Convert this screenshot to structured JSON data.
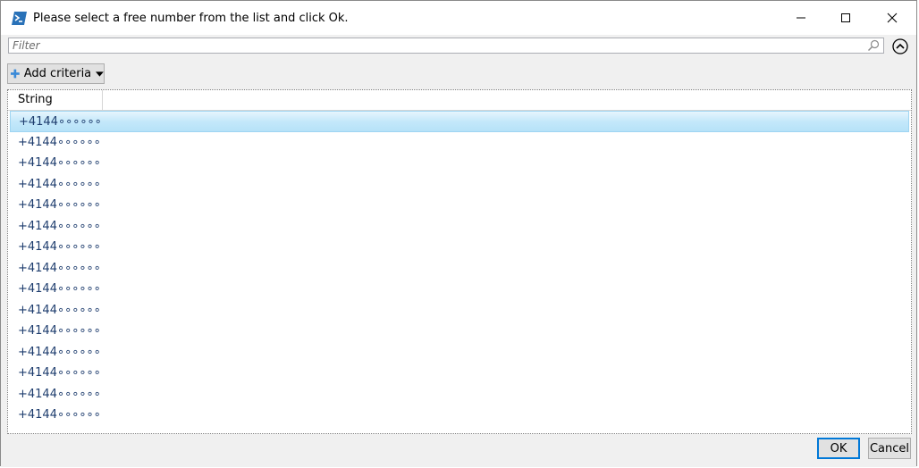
{
  "window": {
    "title": "Please select a free number from the list and click Ok."
  },
  "filter": {
    "placeholder": "Filter"
  },
  "toolbar": {
    "add_criteria_label": "Add criteria"
  },
  "list": {
    "column_header": "String",
    "selected_index": 0,
    "rows": [
      "+4144∘∘∘∘∘∘",
      "+4144∘∘∘∘∘∘",
      "+4144∘∘∘∘∘∘",
      "+4144∘∘∘∘∘∘",
      "+4144∘∘∘∘∘∘",
      "+4144∘∘∘∘∘∘",
      "+4144∘∘∘∘∘∘",
      "+4144∘∘∘∘∘∘",
      "+4144∘∘∘∘∘∘",
      "+4144∘∘∘∘∘∘",
      "+4144∘∘∘∘∘∘",
      "+4144∘∘∘∘∘∘",
      "+4144∘∘∘∘∘∘",
      "+4144∘∘∘∘∘∘",
      "+4144∘∘∘∘∘∘"
    ]
  },
  "buttons": {
    "ok_label": "OK",
    "cancel_label": "Cancel"
  },
  "colors": {
    "accent": "#0078d7",
    "selection": "#c4e8fa",
    "row_text": "#1e3d6e"
  },
  "icons": {
    "app": "powershell-icon",
    "search": "search-icon",
    "collapse": "chevron-up-circle-icon",
    "add": "plus-icon",
    "dropdown": "caret-down-icon"
  }
}
